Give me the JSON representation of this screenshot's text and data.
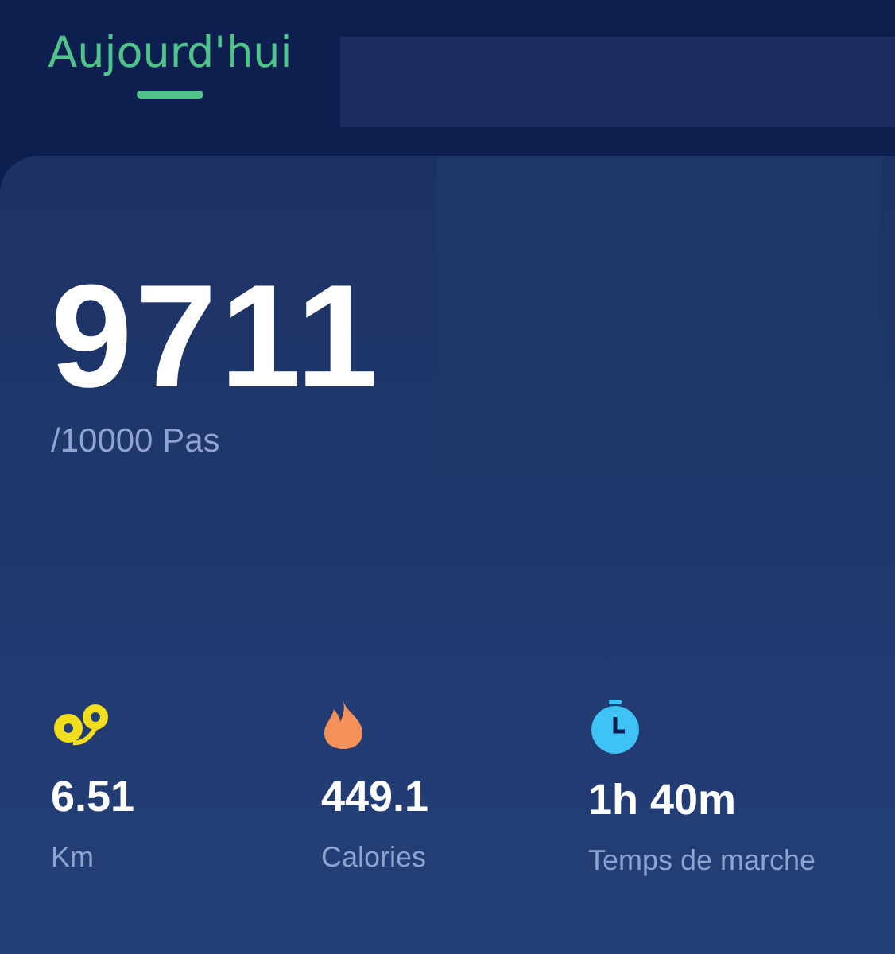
{
  "tabs": [
    {
      "label": "Aujourd'hui",
      "selected": true
    }
  ],
  "steps": {
    "count": "9711",
    "goal": "/10000 Pas"
  },
  "stats": [
    {
      "kind": "distance",
      "value": "6.51",
      "label": "Km"
    },
    {
      "kind": "calories",
      "value": "449.1",
      "label": "Calories"
    },
    {
      "kind": "time",
      "value": "1h 40m",
      "label": "Temps de marche"
    }
  ]
}
